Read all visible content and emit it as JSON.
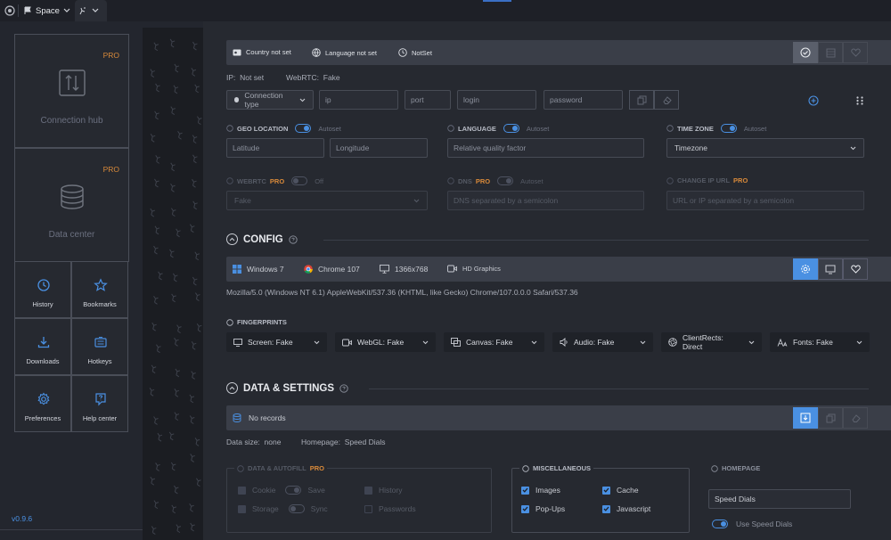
{
  "topbar": {
    "workspace": "Space"
  },
  "sidebar": {
    "connection_hub": {
      "label": "Connection hub",
      "badge": "PRO"
    },
    "data_center": {
      "label": "Data center",
      "badge": "PRO"
    },
    "tiles": {
      "history": "History",
      "bookmarks": "Bookmarks",
      "downloads": "Downloads",
      "hotkeys": "Hotkeys",
      "preferences": "Preferences",
      "help_center": "Help center"
    },
    "version": "v0.9.6"
  },
  "proxy": {
    "country": "Country not set",
    "language": "Language not set",
    "notset": "NotSet",
    "ip_label": "IP:",
    "ip_value": "Not set",
    "webrtc_label": "WebRTC:",
    "webrtc_value": "Fake",
    "connection_type": "Connection type",
    "ip_placeholder": "ip",
    "port_placeholder": "port",
    "login_placeholder": "login",
    "password_placeholder": "password"
  },
  "geo": {
    "geo_label": "GEO LOCATION",
    "autoset": "Autoset",
    "latitude": "Latitude",
    "longitude": "Longitude",
    "language_label": "LANGUAGE",
    "relative_quality": "Relative quality factor",
    "timezone_label": "TIME ZONE",
    "timezone": "Timezone",
    "webrtc_label": "WEBRTC",
    "pro": "PRO",
    "off": "Off",
    "webrtc_value": "Fake",
    "dns_label": "DNS",
    "dns_placeholder": "DNS separated by a semicolon",
    "change_ip_label": "CHANGE IP URL",
    "change_ip_placeholder": "URL or IP separated by a semicolon"
  },
  "config": {
    "title": "CONFIG",
    "os": "Windows 7",
    "browser": "Chrome 107",
    "resolution": "1366x768",
    "gpu": "HD Graphics",
    "user_agent": "Mozilla/5.0 (Windows NT 6.1) AppleWebKit/537.36 (KHTML, like Gecko) Chrome/107.0.0.0 Safari/537.36",
    "fingerprints_label": "FINGERPRINTS",
    "fingerprints": {
      "screen": "Screen: Fake",
      "webgl": "WebGL: Fake",
      "canvas": "Canvas: Fake",
      "audio": "Audio: Fake",
      "clientrects": "ClientRects: Direct",
      "fonts": "Fonts: Fake"
    }
  },
  "data_settings": {
    "title": "DATA & SETTINGS",
    "records": "No records",
    "data_size_label": "Data size:",
    "data_size_value": "none",
    "homepage_label": "Homepage:",
    "homepage_value": "Speed Dials",
    "autofill": {
      "title": "DATA & AUTOFILL",
      "pro": "PRO",
      "cookie": "Cookie",
      "save": "Save",
      "history": "History",
      "storage": "Storage",
      "sync": "Sync",
      "passwords": "Passwords"
    },
    "misc": {
      "title": "MISCELLANEOUS",
      "images": "Images",
      "cache": "Cache",
      "popups": "Pop-Ups",
      "javascript": "Javascript"
    },
    "homepage": {
      "title": "HOMEPAGE",
      "value": "Speed Dials",
      "use_speed_dials": "Use Speed Dials"
    }
  },
  "colors": {
    "accent": "#4a90e2",
    "pro": "#d98a3a",
    "background": "#262930",
    "bar": "#3a3e48"
  }
}
